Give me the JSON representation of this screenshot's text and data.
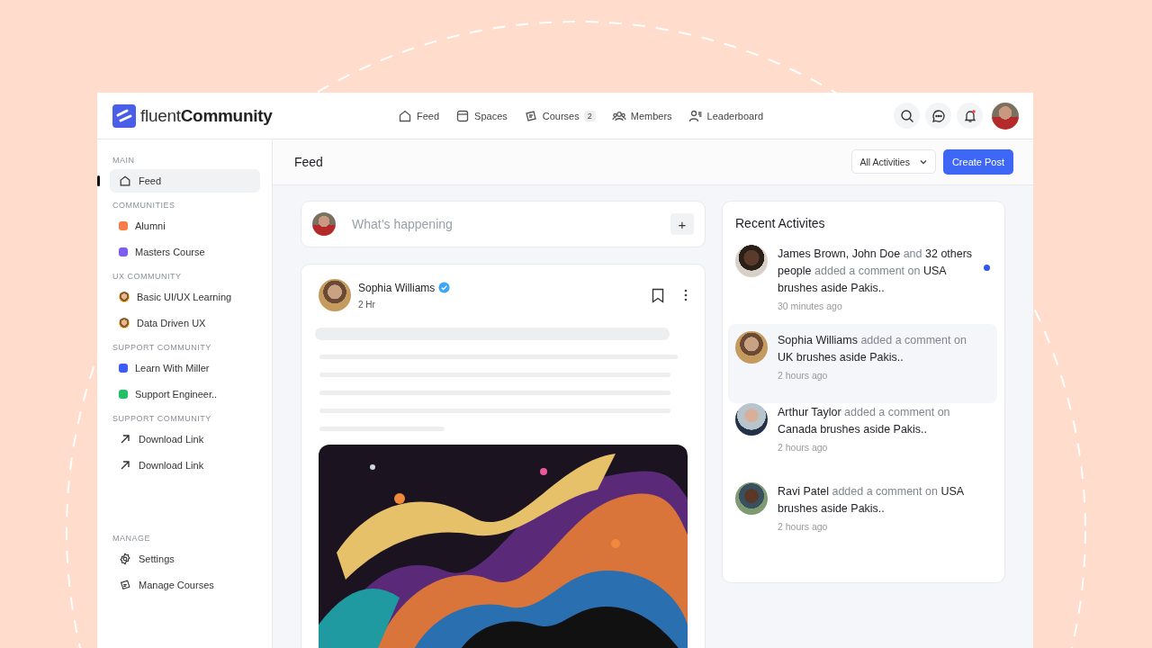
{
  "brand": {
    "light": "fluent",
    "bold": "Community"
  },
  "nav": [
    {
      "label": "Feed"
    },
    {
      "label": "Spaces"
    },
    {
      "label": "Courses",
      "badge": "2"
    },
    {
      "label": "Members"
    },
    {
      "label": "Leaderboard"
    }
  ],
  "notifications": {
    "unread": true
  },
  "sidebar": [
    {
      "heading": "MAIN",
      "items": [
        {
          "kind": "home",
          "label": "Feed",
          "selected": true
        }
      ]
    },
    {
      "heading": "COMMUNITIES",
      "items": [
        {
          "kind": "dot",
          "label": "Alumni",
          "color": "#f97b45",
          "selected": false
        },
        {
          "kind": "dot",
          "label": "Masters Course",
          "color": "#7c5cf5",
          "selected": false
        }
      ]
    },
    {
      "heading": "UX COMMUNITY",
      "items": [
        {
          "kind": "avatar",
          "label": "Basic UI/UX Learning",
          "selected": false
        },
        {
          "kind": "avatar",
          "label": "Data Driven UX",
          "selected": false
        }
      ]
    },
    {
      "heading": "SUPPORT COMMUNITY",
      "items": [
        {
          "kind": "dot",
          "label": "Learn With Miller",
          "color": "#3b5cf5",
          "selected": false
        },
        {
          "kind": "dot",
          "label": "Support Engineer..",
          "color": "#22c065",
          "selected": false
        }
      ]
    },
    {
      "heading": "SUPPORT COMMUNITY",
      "items": [
        {
          "kind": "arrow",
          "label": "Download Link",
          "selected": false
        },
        {
          "kind": "arrow",
          "label": "Download Link",
          "selected": false
        }
      ]
    },
    {
      "heading": "MANAGE",
      "items": [
        {
          "kind": "gear",
          "label": "Settings",
          "selected": false
        },
        {
          "kind": "book",
          "label": "Manage Courses",
          "selected": false
        }
      ]
    }
  ],
  "page_title": "Feed",
  "filter": {
    "value": "All Activities"
  },
  "create_button": "Create Post",
  "composer": {
    "placeholder": "What’s happening",
    "add": "+"
  },
  "post": {
    "author": "Sophia Williams",
    "verified": true,
    "time": "2 Hr"
  },
  "activity": {
    "title": "Recent Activites",
    "items": [
      {
        "text": "**James Brown, John Doe** and **32 others people** added a comment on **USA brushes aside Pakis..**",
        "time": "30 minutes ago",
        "unread": true,
        "selected": false
      },
      {
        "text": "**Sophia Williams** added a comment on **UK brushes aside Pakis..**",
        "time": "2 hours ago",
        "unread": false,
        "selected": true
      },
      {
        "text": "**Arthur Taylor** added a comment on **Canada brushes aside Pakis..**",
        "time": "2 hours ago",
        "unread": false,
        "selected": false
      },
      {
        "text": "**Ravi Patel** added a comment on **USA brushes aside Pakis..**",
        "time": "2 hours ago",
        "unread": false,
        "selected": false
      }
    ]
  }
}
